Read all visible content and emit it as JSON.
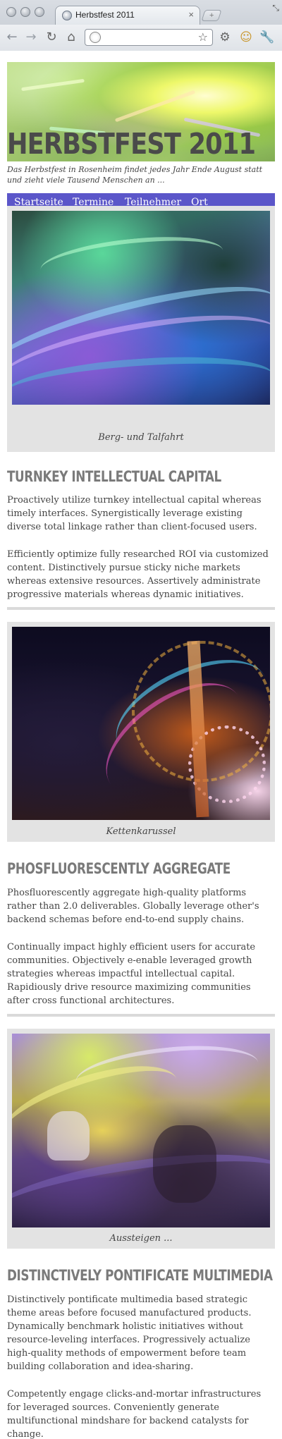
{
  "browser": {
    "tab_title": "Herbstfest 2011",
    "tab_close": "×",
    "newtab_label": "+",
    "address": ""
  },
  "site": {
    "title": "HERBSTFEST 2011",
    "tagline": "Das Herbstfest in Rosenheim findet jedes Jahr Ende August statt und zieht viele Tausend Menschen an ..."
  },
  "nav": {
    "items": [
      "Startseite",
      "Termine",
      "Teilnehmer",
      "Ort"
    ],
    "background": "#5b56c9"
  },
  "figures": [
    {
      "caption": "Berg- und Talfahrt"
    },
    {
      "caption": "Kettenkarussel"
    },
    {
      "caption": "Aussteigen ..."
    }
  ],
  "sections": [
    {
      "title": "TURNKEY INTELLECTUAL CAPITAL",
      "paragraphs": [
        "Proactively utilize turnkey intellectual capital whereas timely interfaces. Synergistically leverage existing diverse total linkage rather than client-focused users.",
        "Efficiently optimize fully researched ROI via customized content. Distinctively pursue sticky niche markets whereas extensive resources. Assertively administrate progressive materials whereas dynamic initiatives."
      ]
    },
    {
      "title": "PHOSFLUORESCENTLY AGGREGATE",
      "paragraphs": [
        "Phosfluorescently aggregate high-quality platforms rather than 2.0 deliverables. Globally leverage other's backend schemas before end-to-end supply chains.",
        "Continually impact highly efficient users for accurate communities. Objectively e-enable leveraged growth strategies whereas impactful intellectual capital. Rapidiously drive resource maximizing communities after cross functional architectures."
      ]
    },
    {
      "title": "DISTINCTIVELY PONTIFICATE MULTIMEDIA",
      "paragraphs": [
        "Distinctively pontificate multimedia based strategic theme areas before focused manufactured products. Dynamically benchmark holistic initiatives without resource-leveling interfaces. Progressively actualize high-quality methods of empowerment before team building collaboration and idea-sharing.",
        "Competently engage clicks-and-mortar infrastructures for leveraged sources. Conveniently generate multifunctional mindshare for backend catalysts for change."
      ]
    }
  ]
}
